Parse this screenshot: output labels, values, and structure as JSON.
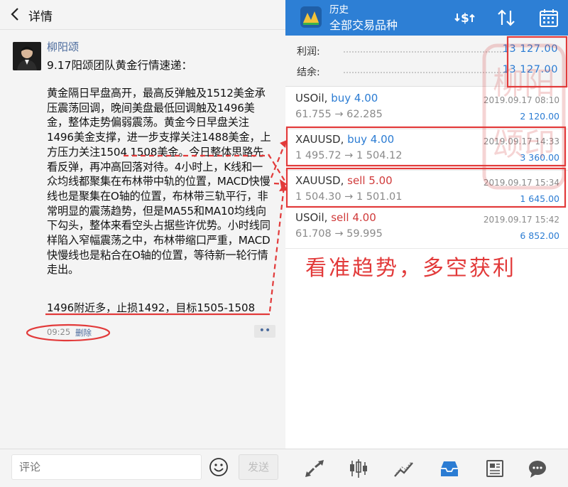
{
  "left": {
    "header_title": "详情",
    "author": "柳阳颂",
    "post_heading": "9.17阳颂团队黄金行情速递：",
    "post_body": "黄金隔日早盘高开，最高反弹触及1512美金承压震荡回调，晚间美盘最低回调触及1496美金，整体走势偏弱震荡。黄金今日早盘关注1496美金支撑，进一步支撑关注1488美金，上方压力关注1504 1508美金。今日整体思路先看反弹，再冲高回落对待。4小时上，K线和一众均线都聚集在布林带中轨的位置，MACD快慢线也是聚集在O轴的位置，布林带三轨平行，非常明显的震荡趋势，但是MA55和MA10均线向下勾头，整体来看空头占据些许优势。小时线同样陷入窄幅震荡之中，布林带缩口严重，MACD快慢线也是粘合在O轴的位置，等待新一轮行情走出。",
    "post_target": "1496附近多，止损1492，目标1505-1508",
    "post_time": "09:25",
    "delete_label": "删除",
    "more_label": "••",
    "comment_placeholder": "评论",
    "send_label": "发送"
  },
  "right": {
    "title": "历史",
    "subtitle": "全部交易品种",
    "summary": {
      "profit_label": "利润:",
      "profit_value": "13 127.00",
      "balance_label": "结余:",
      "balance_value": "13 127.00"
    },
    "trades": [
      {
        "symbol": "USOil,",
        "side": "buy 4.00",
        "side_type": "buy",
        "prices": "61.755 → 62.285",
        "date": "2019.09.17 08:10",
        "profit": "2 120.00"
      },
      {
        "symbol": "XAUUSD,",
        "side": "buy 4.00",
        "side_type": "buy",
        "prices": "1 495.72 → 1 504.12",
        "date": "2019.09.17 14:33",
        "profit": "3 360.00"
      },
      {
        "symbol": "XAUUSD,",
        "side": "sell 5.00",
        "side_type": "sell",
        "prices": "1 504.30 → 1 501.01",
        "date": "2019.09.17 15:34",
        "profit": "1 645.00"
      },
      {
        "symbol": "USOil,",
        "side": "sell 4.00",
        "side_type": "sell",
        "prices": "61.708 → 59.995",
        "date": "2019.09.17 15:42",
        "profit": "6 852.00"
      }
    ],
    "slogan": "看准趋势，多空获利",
    "watermark": "柳阳颂印"
  },
  "colors": {
    "header_blue": "#2d7fd5",
    "value_blue": "#2b7cd3",
    "sell_red": "#d03a3a",
    "annotation_red": "#e23a3a"
  }
}
